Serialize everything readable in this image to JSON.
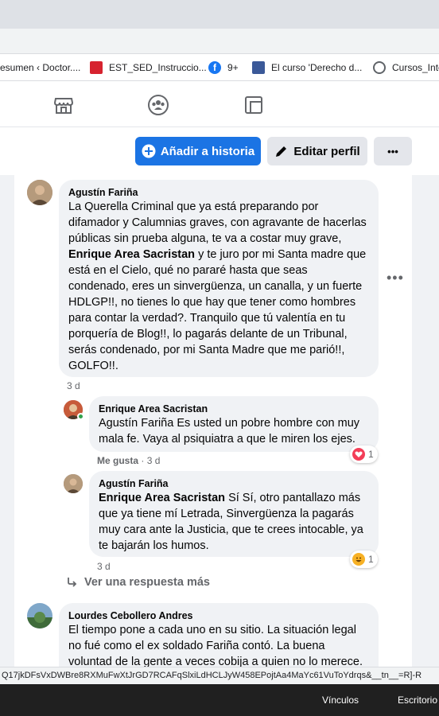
{
  "bookmarks": [
    {
      "label": "esumen ‹ Doctor....",
      "icon": "wordpress-icon",
      "color": "#6c6c6c"
    },
    {
      "label": "EST_SED_Instruccio...",
      "icon": "madrid-icon",
      "color": "#d6232f"
    },
    {
      "label": "9+",
      "icon": "facebook-icon",
      "color": "#1877f2"
    },
    {
      "label": "El curso 'Derecho d...",
      "icon": "site-icon",
      "color": "#3b5998"
    },
    {
      "label": "Cursos_Inte",
      "icon": "globe-icon",
      "color": "#5f6368"
    }
  ],
  "actions": {
    "add_story": "Añadir a historia",
    "edit_profile": "Editar perfil",
    "more": "•••"
  },
  "comments": {
    "c1": {
      "author": "Agustín Fariña",
      "text_a": "La Querella Criminal que ya está preparando por difamador y Calumnias graves, con agravante de hacerlas públicas sin prueba alguna, te va a costar muy grave,",
      "mention": "Enrique Area Sacristan",
      "text_b": "y te juro por mi Santa madre que está en el Cielo, qué no pararé hasta que seas condenado, eres un sinvergüenza, un canalla, y un fuerte HDLGP!!, no tienes lo que hay que tener como hombres para contar la verdad?. Tranquilo que tú valentía en tu porquería de Blog!!, lo pagarás delante de un Tribunal, serás condenado, por mi Santa Madre que me parió!!, GOLFO!!.",
      "time": "3 d"
    },
    "r1": {
      "author": "Enrique Area Sacristan",
      "text": "Agustín Fariña Es usted un pobre hombre con muy mala fe. Vaya al psiquiatra a que le miren los ejes.",
      "like": "Me gusta",
      "sep": " · ",
      "time": "3 d",
      "reaction_count": "1",
      "reaction": "love-icon"
    },
    "r2": {
      "author": "Agustín Fariña",
      "mention": "Enrique Area Sacristan",
      "text": "Sí Sí, otro pantallazo más que ya tiene mí Letrada, Sinvergüenza la pagarás muy cara ante la Justicia, que te crees intocable, ya te bajarán los humos.",
      "time": "3 d",
      "reaction_count": "1",
      "reaction": "haha-icon"
    },
    "more_replies": "Ver una respuesta más",
    "c2": {
      "author": "Lourdes Cebollero Andres",
      "text": "El tiempo pone a cada uno en su sitio. La situación legal no fué como el ex soldado Fariña contó. La buena voluntad de la gente a veces cobija a quien no lo merece."
    }
  },
  "status_url": "Q17jkDFsVxDWBre8RXMuFwXtJrGD7RCAFqSlxiLdHCLJyW458EPojtAa4MaYc61VuToYdrqs&__tn__=R]-R",
  "taskbar": {
    "links": "Vínculos",
    "desktop": "Escritorio"
  },
  "colors": {
    "accent": "#1b74e4",
    "love": "#f33e58",
    "haha": "#f7b125"
  }
}
